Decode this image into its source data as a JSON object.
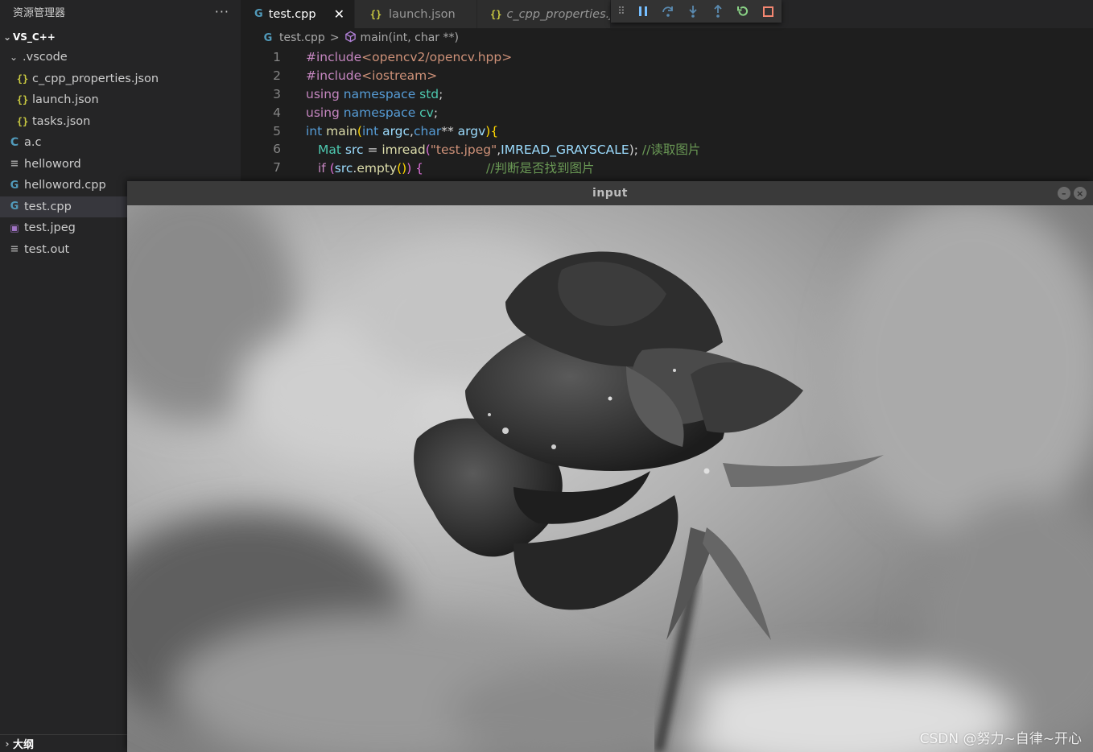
{
  "sidebar": {
    "title": "资源管理器",
    "more": "···",
    "project": "VS_C++",
    "folder": ".vscode",
    "vscode_files": [
      "c_cpp_properties.json",
      "launch.json",
      "tasks.json"
    ],
    "files": [
      "a.c",
      "helloword",
      "helloword.cpp",
      "test.cpp",
      "test.jpeg",
      "test.out"
    ],
    "outline": "大纲"
  },
  "icons": {
    "json": "{}",
    "c": "C",
    "cpp": "G",
    "file": "≡",
    "image": "▣",
    "chevron_down": "⌄",
    "chevron_right": "›"
  },
  "tabs": [
    {
      "label": "test.cpp",
      "icon": "cpp",
      "active": true
    },
    {
      "label": "launch.json",
      "icon": "json"
    },
    {
      "label": "c_cpp_properties.json",
      "icon": "json"
    }
  ],
  "breadcrumb": {
    "file": "test.cpp",
    "separator": ">",
    "symbol": "main(int, char **)"
  },
  "editor": {
    "line_numbers": [
      "1",
      "2",
      "3",
      "4",
      "5",
      "6",
      "7"
    ],
    "line1": {
      "a": "#include",
      "b": "<opencv2/opencv.hpp>"
    },
    "line2": {
      "a": "#include",
      "b": "<iostream>"
    },
    "line3": {
      "a": "using ",
      "b": "namespace ",
      "c": "std",
      "d": ";"
    },
    "line4": {
      "a": "using ",
      "b": "namespace ",
      "c": "cv",
      "d": ";"
    },
    "line5": {
      "a": "int ",
      "b": "main",
      "c": "(",
      "d": "int ",
      "e": "argc",
      "f": ",",
      "g": "char",
      "h": "** ",
      "i": "argv",
      "j": ")",
      "k": "{"
    },
    "line6": {
      "a": "Mat ",
      "b": "src",
      "c": " = ",
      "d": "imread",
      "e": "(",
      "f": "\"test.jpeg\"",
      "g": ",",
      "h": "IMREAD_GRAYSCALE",
      "i": ");",
      "j": " //读取图片"
    },
    "line7": {
      "a": "if ",
      "b": "(",
      "c": "src",
      "d": ".",
      "e": "empty",
      "f": "()",
      "g": ") {",
      "h": "//判断是否找到图片"
    }
  },
  "cv_window": {
    "title": "input"
  },
  "watermark": "CSDN @努力~自律~开心",
  "colors": {
    "accent": "#75beff",
    "sidebar_bg": "#252526",
    "editor_bg": "#1e1e1e",
    "selected_row": "#37373d"
  }
}
